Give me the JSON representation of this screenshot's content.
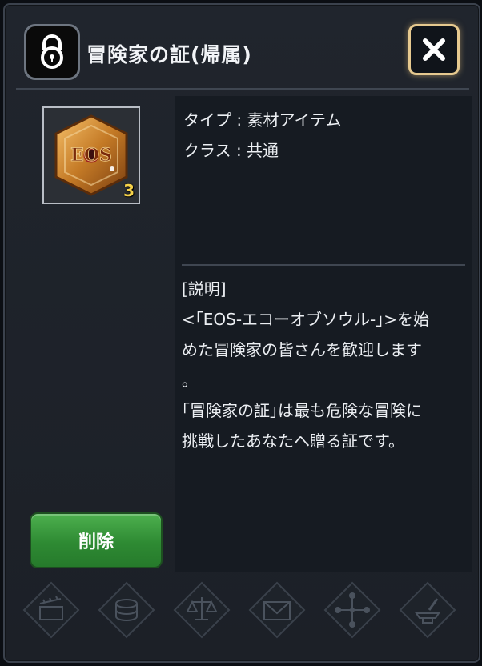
{
  "header": {
    "title": "冒険家の証(帰属)"
  },
  "item": {
    "icon_text": "EOS",
    "quantity": "3"
  },
  "info": {
    "type_line": "タイプ : 素材アイテム",
    "class_line": "クラス : 共通",
    "desc_heading": "[説明]",
    "desc_line1": "<｢EOS-エコーオブソウル-｣>を始",
    "desc_line2": "めた冒険家の皆さんを歓迎します",
    "desc_line3": "。",
    "desc_line4": "｢冒険家の証｣は最も危険な冒険に",
    "desc_line5": "挑戦したあなたへ贈る証です。"
  },
  "buttons": {
    "delete_label": "削除"
  },
  "actions": [
    {
      "icon": "clapperboard-icon"
    },
    {
      "icon": "coin-stack-icon"
    },
    {
      "icon": "scale-icon"
    },
    {
      "icon": "mail-icon"
    },
    {
      "icon": "network-icon"
    },
    {
      "icon": "anvil-icon"
    }
  ],
  "colors": {
    "accent_gold": "#e6c98f",
    "button_green": "#2e8a33",
    "qty_yellow": "#f5d24a"
  }
}
